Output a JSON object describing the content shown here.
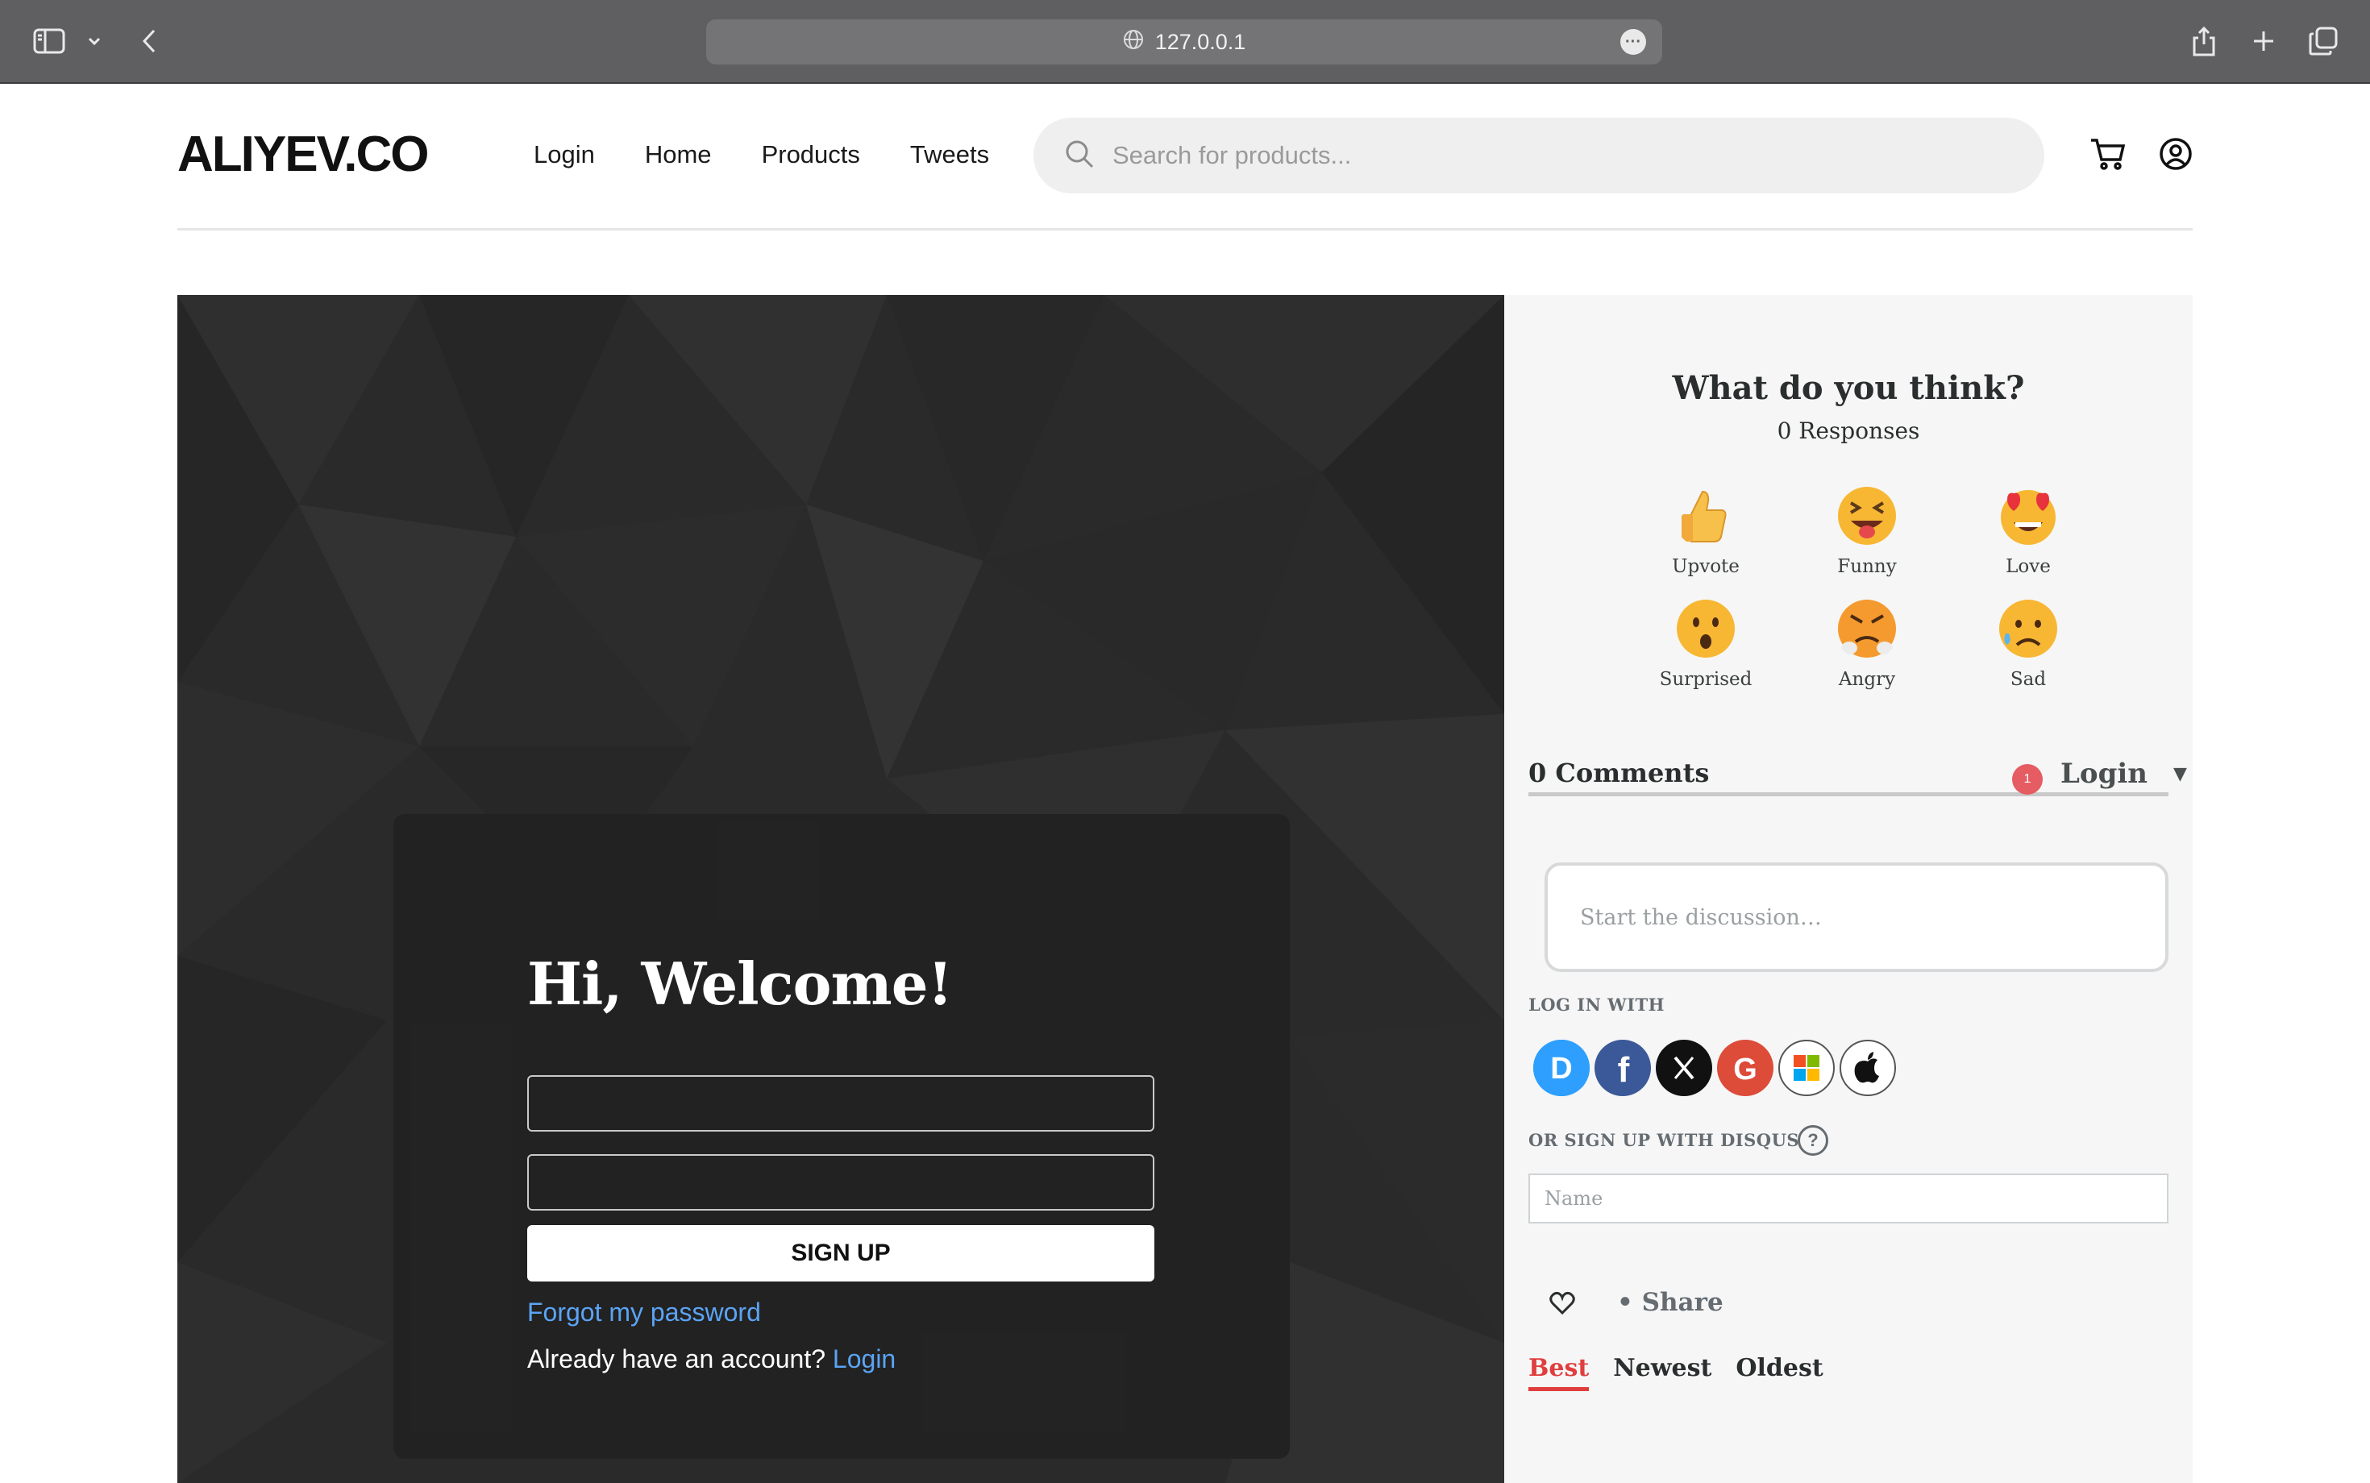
{
  "browser": {
    "url": "127.0.0.1"
  },
  "site": {
    "logo": "ALIYEV.CO",
    "nav": [
      "Login",
      "Home",
      "Products",
      "Tweets"
    ],
    "search_placeholder": "Search for products..."
  },
  "auth": {
    "title": "Hi, Welcome!",
    "signup_label": "SIGN UP",
    "forgot_label": "Forgot my password",
    "already_text": "Already have an account?",
    "login_link": "Login"
  },
  "disqus": {
    "question": "What do you think?",
    "responses": "0 Responses",
    "reactions": [
      {
        "label": "Upvote",
        "icon": "thumbs-up-icon"
      },
      {
        "label": "Funny",
        "icon": "laughing-face-icon"
      },
      {
        "label": "Love",
        "icon": "heart-eyes-icon"
      },
      {
        "label": "Surprised",
        "icon": "surprised-face-icon"
      },
      {
        "label": "Angry",
        "icon": "angry-face-icon"
      },
      {
        "label": "Sad",
        "icon": "sad-face-icon"
      }
    ],
    "comments_label": "0 Comments",
    "notification_count": "1",
    "login_label": "Login",
    "discussion_placeholder": "Start the discussion…",
    "log_in_with": "LOG IN WITH",
    "social": [
      "Disqus",
      "Facebook",
      "X",
      "Google",
      "Microsoft",
      "Apple"
    ],
    "or_signup": "OR SIGN UP WITH DISQUS",
    "name_placeholder": "Name",
    "share_label": "Share",
    "sort": [
      "Best",
      "Newest",
      "Oldest"
    ],
    "sort_active": "Best",
    "colors": {
      "accent": "#e03e3e",
      "link": "#5ba4f5"
    }
  }
}
